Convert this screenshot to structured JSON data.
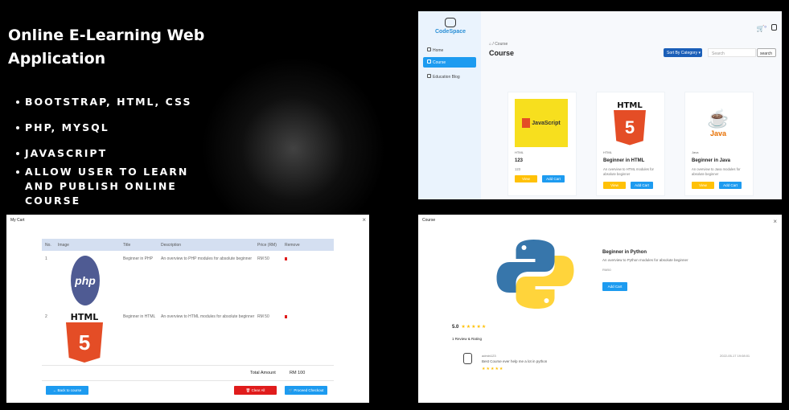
{
  "hero": {
    "title": "Online E-Learning Web Application",
    "features": [
      "BOOTSTRAP, HTML, CSS",
      "PHP, MYSQL",
      "JAVASCRIPT",
      "ALLOW USER TO LEARN AND PUBLISH ONLINE COURSE"
    ]
  },
  "course_page": {
    "logo": "CodeSpace",
    "nav": [
      {
        "label": "Home",
        "icon": "home-icon"
      },
      {
        "label": "Course",
        "icon": "course-icon",
        "active": true
      },
      {
        "label": "Education Blog",
        "icon": "blog-icon"
      }
    ],
    "breadcrumb": "⌂  /  Course",
    "title": "Course",
    "category_button": "Sort By Category ▾",
    "search_placeholder": "Search",
    "search_button": "search",
    "cart_icon": "🛒",
    "cart_count": "0",
    "cards": [
      {
        "category": "HTML",
        "name": "123",
        "desc": "123",
        "view": "View",
        "add": "Add Cart",
        "image": "javascript-logo",
        "image_text": "JavaScript"
      },
      {
        "category": "HTML",
        "name": "Beginner in HTML",
        "desc": "An overview to HTML modules for absolute beginner",
        "view": "View",
        "add": "Add Cart",
        "image": "html5-logo",
        "image_text": "HTML",
        "image_num": "5"
      },
      {
        "category": "Java",
        "name": "Beginner in Java",
        "desc": "An overview to Java modules for absolute beginner",
        "view": "View",
        "add": "Add Cart",
        "image": "java-logo",
        "image_text": "Java"
      }
    ]
  },
  "cart": {
    "title": "My Cart",
    "close": "×",
    "headers": [
      "No.",
      "Image",
      "Title",
      "Description",
      "Price (RM)",
      "Remove"
    ],
    "rows": [
      {
        "no": "1",
        "title": "Beginner in PHP",
        "desc": "An overview to PHP modules for absolute beginner",
        "price": "RM 50",
        "image_text": "php"
      },
      {
        "no": "2",
        "title": "Beginner in HTML",
        "desc": "An overview to HTML modules for absolute beginner",
        "price": "RM 50",
        "image_text": "HTML",
        "image_num": "5"
      }
    ],
    "total_label": "Total Amount",
    "total_value": "RM 100",
    "back": "← Back to course",
    "clear": "🗑 Clear All",
    "checkout": "🛒 Proceed Checkout"
  },
  "detail": {
    "title": "Course",
    "close": "×",
    "course_name": "Beginner in Python",
    "course_desc": "An overview to Python modules for absolute beginner",
    "price": "RM50",
    "add": "Add Cart",
    "rating": "5.0",
    "rating_stars": "★★★★★",
    "reviews_label": "1 Review & Rating",
    "review": {
      "name": "admin123",
      "text": "Best Course ever help me a lot in python",
      "stars": "★★★★★",
      "date": "2022-05-17 19:08:01"
    }
  },
  "colors": {
    "primary": "#1d9bf0",
    "warning": "#ffc107",
    "danger": "#e01c1c",
    "navy": "#1b5fb8"
  }
}
